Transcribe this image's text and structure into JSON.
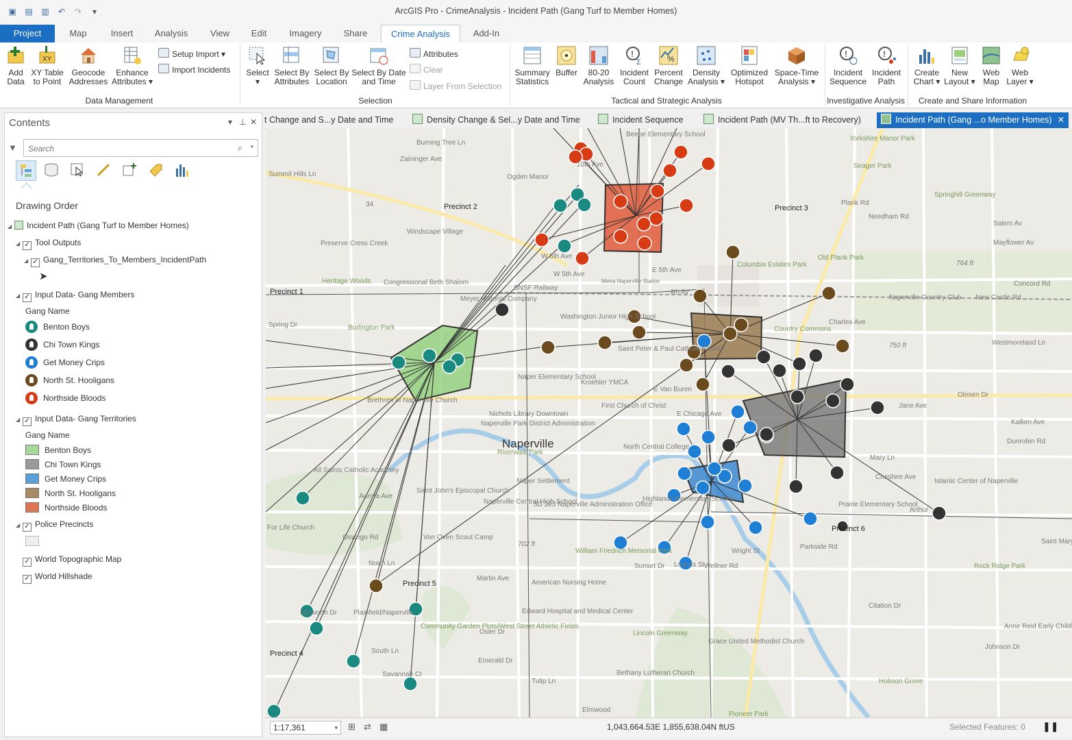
{
  "app": {
    "title": "ArcGIS Pro - CrimeAnalysis - Incident Path (Gang Turf to Member Homes)"
  },
  "ribbon_tabs": [
    "Project",
    "Map",
    "Insert",
    "Analysis",
    "View",
    "Edit",
    "Imagery",
    "Share",
    "Crime Analysis",
    "Add-In"
  ],
  "ribbon": {
    "data_mgmt": {
      "buttons": [
        "Add\nData",
        "XY Table\nto Point",
        "Geocode\nAddresses",
        "Enhance\nAttributes ▾"
      ],
      "small": [
        "Setup Import ▾",
        "Import Incidents"
      ],
      "label": "Data Management"
    },
    "selection": {
      "buttons": [
        "Select\n▾",
        "Select By\nAttributes",
        "Select By\nLocation",
        "Select By Date\nand Time"
      ],
      "small": [
        "Attributes",
        "Clear",
        "Layer From Selection"
      ],
      "label": "Selection"
    },
    "tactical": {
      "buttons": [
        "Summary\nStatistics",
        "Buffer",
        "80-20\nAnalysis",
        "Incident\nCount",
        "Percent\nChange",
        "Density\nAnalysis ▾",
        "Optimized\nHotspot",
        "Space-Time\nAnalysis ▾"
      ],
      "label": "Tactical and Strategic Analysis"
    },
    "investigative": {
      "buttons": [
        "Incident\nSequence",
        "Incident\nPath"
      ],
      "label": "Investigative Analysis"
    },
    "share": {
      "buttons": [
        "Create\nChart ▾",
        "New\nLayout ▾",
        "Web\nMap",
        "Web\nLayer ▾"
      ],
      "label": "Create and Share Information"
    }
  },
  "contents": {
    "title": "Contents",
    "search_placeholder": "Search",
    "drawing_order": "Drawing Order",
    "map_name": "Incident Path (Gang Turf to Member Homes)",
    "tool_outputs": "Tool Outputs",
    "incident_path_layer": "Gang_Territories_To_Members_IncidentPath",
    "members_layer": "Input Data- Gang Members",
    "members_field": "Gang Name",
    "territories_layer": "Input Data- Gang Territories",
    "territories_field": "Gang Name",
    "gangs": [
      {
        "name": "Benton Boys",
        "marker": "#1a8a80",
        "fill": "#a9d99a"
      },
      {
        "name": "Chi Town Kings",
        "marker": "#333333",
        "fill": "#9a9a9a"
      },
      {
        "name": "Get Money Crips",
        "marker": "#1f7fd4",
        "fill": "#5aa0d6"
      },
      {
        "name": "North St. Hooligans",
        "marker": "#6b4a1e",
        "fill": "#a88a63"
      },
      {
        "name": "Northside Bloods",
        "marker": "#d63b14",
        "fill": "#de7554"
      }
    ],
    "precincts_layer": "Police Precincts",
    "topo_layer": "World Topographic Map",
    "hillshade_layer": "World Hillshade"
  },
  "doc_tabs": [
    "t Change and S...y Date and Time",
    "Density Change & Sel...y Date and Time",
    "Incident Sequence",
    "Incident Path (MV Th...ft to Recovery)",
    "Incident Path (Gang ...o Member Homes)"
  ],
  "map": {
    "precincts": [
      "Precinct 1",
      "Precinct 2",
      "Precinct 3",
      "Precinct 4",
      "Precinct 5",
      "Precinct 6"
    ],
    "city": "Naperville",
    "places": [
      "Burning Tree Ln",
      "Zaininger Ave",
      "Ogden Manor",
      "Windscape Village",
      "Preserve Cress Creek",
      "Heritage Woods",
      "Congressional Beth Shalom",
      "Burlington Park",
      "Meyer Material Company",
      "Washington Junior High School",
      "Naper Elementary School",
      "Kroehler YMCA",
      "Saint Peter & Paul Catholic Church",
      "Columbia Estates Park",
      "Country Commons",
      "Naperville Country Club",
      "Old Plank Park",
      "Springhill Greenway",
      "Yorkshire Manor Park",
      "Seager Park",
      "Salem Av",
      "Mayflower Av",
      "Jane Ave",
      "Kallien Ave",
      "Dunrobin Rd",
      "Mary Ln",
      "Cheshire Ave",
      "Islamic Center of Naperville",
      "Prairie Elementary School",
      "Parkside Rd",
      "Rock Ridge Park",
      "North Central College",
      "Naperville Park District Administration",
      "Nichols Library Downtown",
      "First Church of Christ",
      "Riverwalk Park",
      "All Saints Catholic Academy",
      "Naper Settlement",
      "Saint John's Episcopal Church",
      "Naperville Central High School",
      "SD 203 Naperville Administration Office",
      "Von Oven Scout Camp",
      "William Friedrich Memorial Park",
      "Highlands Elementary School",
      "American Nursing Home",
      "Edward Hospital and Medical Center",
      "Community Garden Plots/West Street Athletic Fields",
      "Lincoln Greenway",
      "Grace United Methodist Church",
      "Bethany Lutheran Church",
      "Hobson Grove",
      "Anne Reid Early Childhood Center",
      "Saint Mary",
      "Beebe Elementary School",
      "Brethren of Naperville Church",
      "For Life Church",
      "Elmwood",
      "Pioneer Park",
      "Martin Ave",
      "North Ln",
      "South Ln",
      "Aurora Ave",
      "Oswego Rd",
      "E Chicago Ave",
      "E Van Buren",
      "E 5th Ave",
      "4th Av",
      "W 5th Ave",
      "W 6th Ave",
      "10th Ave",
      "BNSF Railway",
      "Metra Naperville Station",
      "Spring Dr",
      "Plank Rd",
      "Needham Rd",
      "Concord Rd",
      "Westmoreland Ln",
      "Olesen Dr",
      "Arthur",
      "Citation Dr",
      "Johnson Dr",
      "Wright St",
      "Loomis St",
      "Sunset Dr",
      "Wellner Rd",
      "Emerald Dr",
      "Tulip Ln",
      "Plainfield/Naperville",
      "Osler Dr",
      "Savannah Cr",
      "Ellsworth Dr",
      "Summit Hills Ln",
      "New Castle Rd",
      "Charles Ave",
      "764 ft",
      "750 ft",
      "702 ft",
      "34"
    ]
  },
  "status": {
    "scale": "1:17,361",
    "coords": "1,043,664.53E 1,855,638.04N ftUS",
    "selected": "Selected Features: 0"
  }
}
